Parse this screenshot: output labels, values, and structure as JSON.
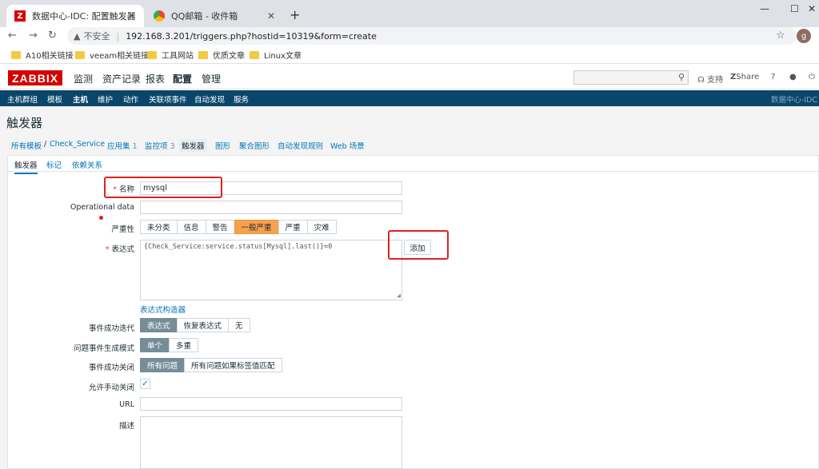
{
  "browser": {
    "tabs": [
      {
        "title": "数据中心-IDC: 配置触发器",
        "favicon": "zabbix-favicon"
      },
      {
        "title": "QQ邮箱 - 收件箱",
        "favicon": "qq-favicon"
      }
    ],
    "new_tab": "+",
    "window_controls": {
      "minimize": "—",
      "maximize": "☐",
      "close": "✕"
    },
    "nav": {
      "back": "←",
      "forward": "→",
      "reload": "↻"
    },
    "security_label": "不安全",
    "url": "192.168.3.201/triggers.php?hostid=10319&form=create",
    "profile_initial": "g",
    "bookmarks": [
      "A10相关链接",
      "veeam相关链接",
      "工具网站",
      "优质文章",
      "Linux文章"
    ]
  },
  "zabbix": {
    "logo": "ZABBIX",
    "menu": [
      "监测",
      "资产记录",
      "报表",
      "配置",
      "管理"
    ],
    "active_menu": "配置",
    "header_tools": {
      "support": "支持",
      "share": "Share",
      "help": "?",
      "user": "user-icon",
      "logout": "power-icon"
    },
    "submenu": [
      "主机群组",
      "模板",
      "主机",
      "维护",
      "动作",
      "关联项事件",
      "自动发现",
      "服务"
    ],
    "active_submenu": "主机",
    "submenu_right": "数据中心-IDC"
  },
  "page": {
    "title": "触发器",
    "breadcrumb": {
      "all_templates": "所有模板",
      "separator": "/",
      "host": "Check_Service",
      "apps": {
        "label": "应用集",
        "count": "1"
      },
      "items": {
        "label": "监控项",
        "count": "3"
      },
      "triggers": "触发器",
      "graphs": "图形",
      "screens": "聚合图形",
      "discovery": "自动发现规则",
      "web": "Web 场景"
    },
    "form_tabs": [
      "触发器",
      "标记",
      "依赖关系"
    ]
  },
  "form": {
    "name": {
      "label": "名称",
      "value": "mysql"
    },
    "opdata": {
      "label": "Operational data",
      "value": ""
    },
    "severity": {
      "label": "严重性",
      "options": [
        "未分类",
        "信息",
        "警告",
        "一般严重",
        "严重",
        "灾难"
      ],
      "selected": "一般严重"
    },
    "expression": {
      "label": "表达式",
      "value": "{Check_Service:service.status[Mysql].last()}=0",
      "add_button": "添加",
      "constructor_link": "表达式构造器"
    },
    "ok_event": {
      "label": "事件成功迭代",
      "options": [
        "表达式",
        "恢复表达式",
        "无"
      ],
      "selected": "表达式"
    },
    "problem_mode": {
      "label": "问题事件生成模式",
      "options": [
        "单个",
        "多重"
      ],
      "selected": "单个"
    },
    "ok_close": {
      "label": "事件成功关闭",
      "options": [
        "所有问题",
        "所有问题如果标签值匹配"
      ],
      "selected": "所有问题"
    },
    "manual_close": {
      "label": "允许手动关闭",
      "checked": true
    },
    "url": {
      "label": "URL",
      "value": ""
    },
    "description": {
      "label": "描述",
      "value": ""
    }
  },
  "colors": {
    "zabbix_red": "#d40000",
    "nav_blue": "#0a466a",
    "link_blue": "#0275b8",
    "severity_orange": "#f7a14c",
    "annotation_red": "#e02020"
  }
}
